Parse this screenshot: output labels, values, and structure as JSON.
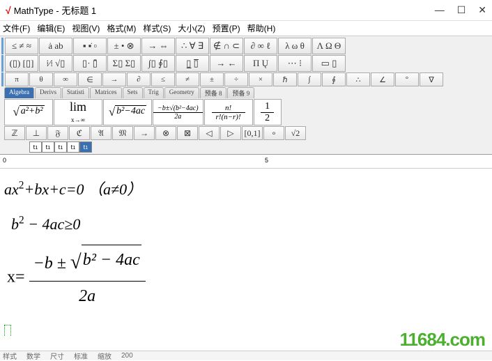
{
  "window": {
    "title": "MathType - 无标题 1"
  },
  "menu": {
    "file": "文件(F)",
    "edit": "编辑(E)",
    "view": "视图(V)",
    "format": "格式(M)",
    "style": "样式(S)",
    "size": "大小(Z)",
    "pref": "预置(P)",
    "help": "帮助(H)"
  },
  "palettes": {
    "row1": [
      "≤ ≠ ≈",
      "ȧ ab",
      "▪ ▪̇ ▫",
      "± • ⊗",
      "→ ⇔",
      "∴ ∀ ∃",
      "∉ ∩ ⊂",
      "∂ ∞ ℓ",
      "λ ω θ",
      "Λ Ω Θ"
    ],
    "row2": [
      "(▯) [▯]",
      "⁞⁄⁞ √▯",
      "▯· ▯̄",
      "Σ▯ Σ▯͏",
      "∫▯ ∮▯",
      "▯̲ ▯̅",
      "→ ←",
      "Π Ų",
      "⋯ ⁝",
      "▭ ▯"
    ],
    "row3": [
      "π",
      "θ",
      "∞",
      "∈",
      "→",
      "∂",
      "≤",
      "≠",
      "±",
      "÷",
      "×",
      "ℏ",
      "∫",
      "∮",
      "∴",
      "∠",
      "°",
      "∇"
    ]
  },
  "tabs": [
    "Algebra",
    "Derivs",
    "Statisti",
    "Matrices",
    "Sets",
    "Trig",
    "Geometry",
    "预备 8",
    "预备 9"
  ],
  "bigcells": [
    "√(a²+b²)",
    "lim x→∞",
    "√(b²−4ac)",
    "(-b±√(b²-4ac))/2a",
    "n!/(r!(n−r)!)",
    "1/2"
  ],
  "smallbar": [
    "ℤ",
    "⊥",
    "𝔉",
    "ℭ",
    "𝔄",
    "𝔐",
    "→",
    "⊗",
    "⊠",
    "◁",
    "▷",
    "[0,1]",
    "∘",
    "√2"
  ],
  "equations": {
    "eq1_a": "ax",
    "eq1_b": "+bx+c=0  （a≠0）",
    "eq2_a": "b",
    "eq2_b": " − 4ac",
    "eq2_c": "≥",
    "eq2_d": "0",
    "eq3_lhs": "x=",
    "eq3_num_a": "−b ± ",
    "eq3_sqrt": "b² − 4ac",
    "eq3_den": "2a"
  },
  "status": {
    "s1": "样式",
    "s2": "数学",
    "s3": "尺寸",
    "s4": "标准",
    "s5": "缩放",
    "s6": "200"
  },
  "watermark": "11684.com"
}
